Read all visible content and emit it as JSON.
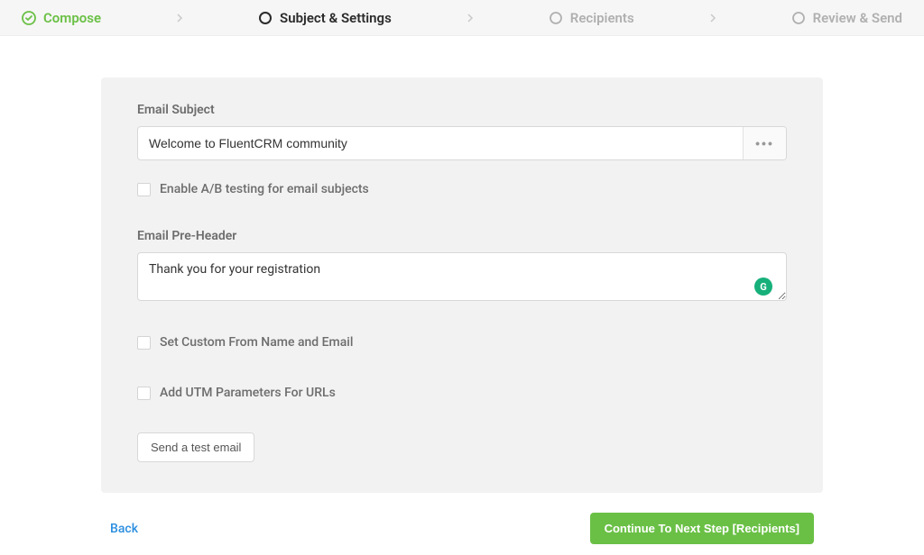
{
  "stepper": {
    "steps": [
      {
        "label": "Compose",
        "state": "completed"
      },
      {
        "label": "Subject & Settings",
        "state": "active"
      },
      {
        "label": "Recipients",
        "state": "upcoming"
      },
      {
        "label": "Review & Send",
        "state": "upcoming"
      }
    ]
  },
  "form": {
    "subject_label": "Email Subject",
    "subject_value": "Welcome to FluentCRM community",
    "ab_test_label": "Enable A/B testing for email subjects",
    "preheader_label": "Email Pre-Header",
    "preheader_value": "Thank you for your registration",
    "custom_from_label": "Set Custom From Name and Email",
    "utm_label": "Add UTM Parameters For URLs",
    "test_email_label": "Send a test email"
  },
  "footer": {
    "back_label": "Back",
    "next_label": "Continue To Next Step [Recipients]"
  }
}
